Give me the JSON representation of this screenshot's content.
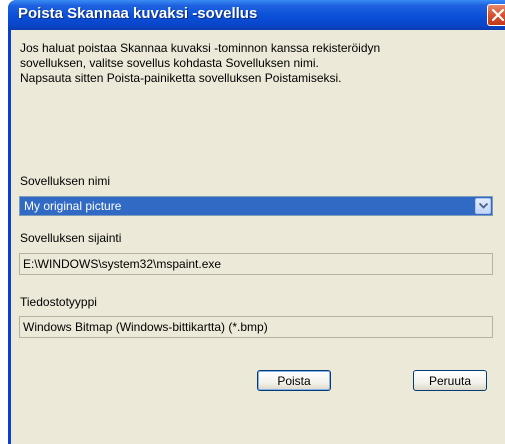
{
  "window": {
    "title": "Poista Skannaa kuvaksi -sovellus",
    "close_icon": "close-icon"
  },
  "description": {
    "lines": [
      "Jos haluat poistaa Skannaa kuvaksi -tominnon kanssa rekisteröidyn",
      "sovelluksen, valitse sovellus kohdasta Sovelluksen nimi.",
      "Napsauta sitten Poista-painiketta sovelluksen Poistamiseksi."
    ]
  },
  "app_name": {
    "label": "Sovelluksen nimi",
    "selected": "My original picture",
    "arrow_icon": "chevron-down-icon"
  },
  "app_location": {
    "label": "Sovelluksen sijainti",
    "value": "E:\\WINDOWS\\system32\\mspaint.exe"
  },
  "file_type": {
    "label": "Tiedostotyyppi",
    "value": "Windows Bitmap (Windows-bittikartta) (*.bmp)"
  },
  "buttons": {
    "delete": "Poista",
    "cancel": "Peruuta"
  },
  "colors": {
    "title_bar": "#0a4fd8",
    "dialog_face": "#ece9d8",
    "selection": "#316ac5",
    "close_button": "#d9512c"
  }
}
